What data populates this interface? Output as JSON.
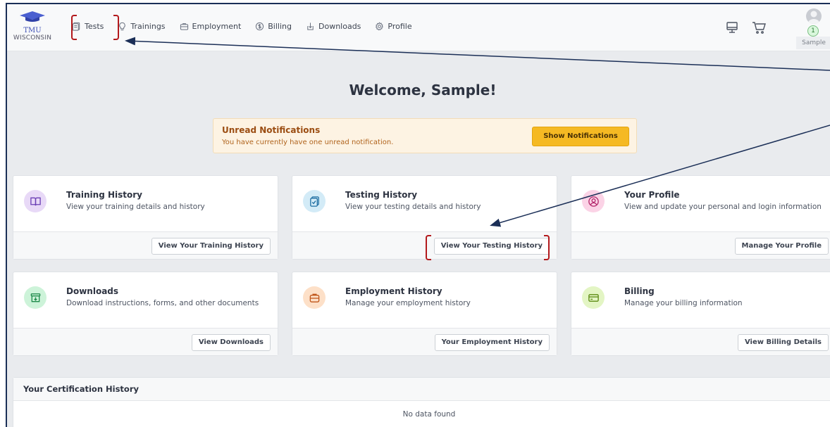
{
  "brand": {
    "line1": "TMU",
    "line2": "WISCONSIN"
  },
  "nav": [
    {
      "label": "Tests",
      "icon": "tests-icon"
    },
    {
      "label": "Trainings",
      "icon": "lightbulb-icon"
    },
    {
      "label": "Employment",
      "icon": "briefcase-icon"
    },
    {
      "label": "Billing",
      "icon": "dollar-icon"
    },
    {
      "label": "Downloads",
      "icon": "download-icon"
    },
    {
      "label": "Profile",
      "icon": "gear-icon"
    }
  ],
  "toolbar": {
    "icons": [
      "monitor-icon",
      "cart-icon"
    ]
  },
  "user": {
    "name": "Sample",
    "badge": "1"
  },
  "welcome": "Welcome, Sample!",
  "notification": {
    "title": "Unread Notifications",
    "text": "You have currently have one unread notification.",
    "button": "Show Notifications"
  },
  "cards": [
    {
      "title": "Training History",
      "desc": "View your training details and history",
      "button": "View Your Training History",
      "icon": "book-icon",
      "color": "#e8d9f7"
    },
    {
      "title": "Testing History",
      "desc": "View your testing details and history",
      "button": "View Your Testing History",
      "icon": "clipboard-check-icon",
      "color": "#d3ebf7"
    },
    {
      "title": "Your Profile",
      "desc": "View and update your personal and login information",
      "button": "Manage Your Profile",
      "icon": "user-circle-icon",
      "color": "#fbd3e6"
    },
    {
      "title": "Downloads",
      "desc": "Download instructions, forms, and other documents",
      "button": "View Downloads",
      "icon": "archive-download-icon",
      "color": "#cdf3d9"
    },
    {
      "title": "Employment History",
      "desc": "Manage your employment history",
      "button": "Your Employment History",
      "icon": "briefcase-icon",
      "color": "#fde0c8"
    },
    {
      "title": "Billing",
      "desc": "Manage your billing information",
      "button": "View Billing Details",
      "icon": "credit-card-icon",
      "color": "#e3f5c4"
    }
  ],
  "certification": {
    "title": "Your Certification History",
    "empty": "No data found"
  },
  "colors": {
    "accent": "#f5b923",
    "annotation_arrow": "#1b2f57",
    "annotation_bracket": "#b3191c"
  }
}
